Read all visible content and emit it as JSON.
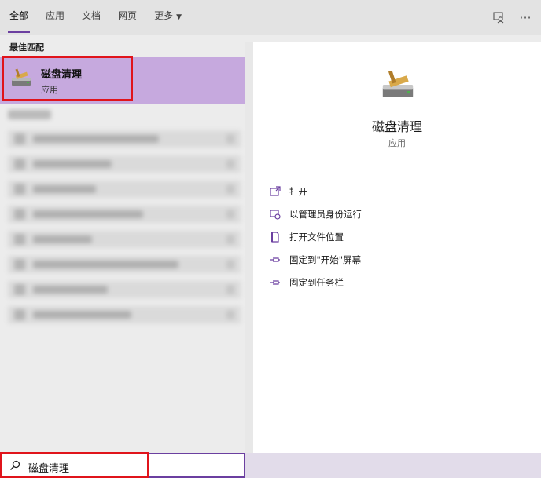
{
  "tabs": [
    {
      "label": "全部",
      "active": true
    },
    {
      "label": "应用",
      "active": false
    },
    {
      "label": "文档",
      "active": false
    },
    {
      "label": "网页",
      "active": false
    },
    {
      "label": "更多",
      "active": false,
      "has_dropdown": true
    }
  ],
  "toolbar": {
    "feedback_icon": "feedback-person-icon",
    "more_label": "···"
  },
  "best_match": {
    "section_label": "最佳匹配",
    "name": "磁盘清理",
    "type": "应用",
    "icon": "disk-cleanup-icon"
  },
  "detail": {
    "title": "磁盘清理",
    "subtitle": "应用",
    "icon": "disk-cleanup-icon"
  },
  "actions": [
    {
      "label": "打开",
      "icon": "open-window-icon"
    },
    {
      "label": "以管理员身份运行",
      "icon": "run-as-admin-icon"
    },
    {
      "label": "打开文件位置",
      "icon": "file-location-icon"
    },
    {
      "label": "固定到\"开始\"屏幕",
      "icon": "pin-start-icon"
    },
    {
      "label": "固定到任务栏",
      "icon": "pin-taskbar-icon"
    }
  ],
  "search": {
    "value": "磁盘清理",
    "icon": "search-icon"
  },
  "colors": {
    "accent": "#6b3fa0",
    "highlight": "#c6a9de",
    "annotation": "#e0141b"
  }
}
